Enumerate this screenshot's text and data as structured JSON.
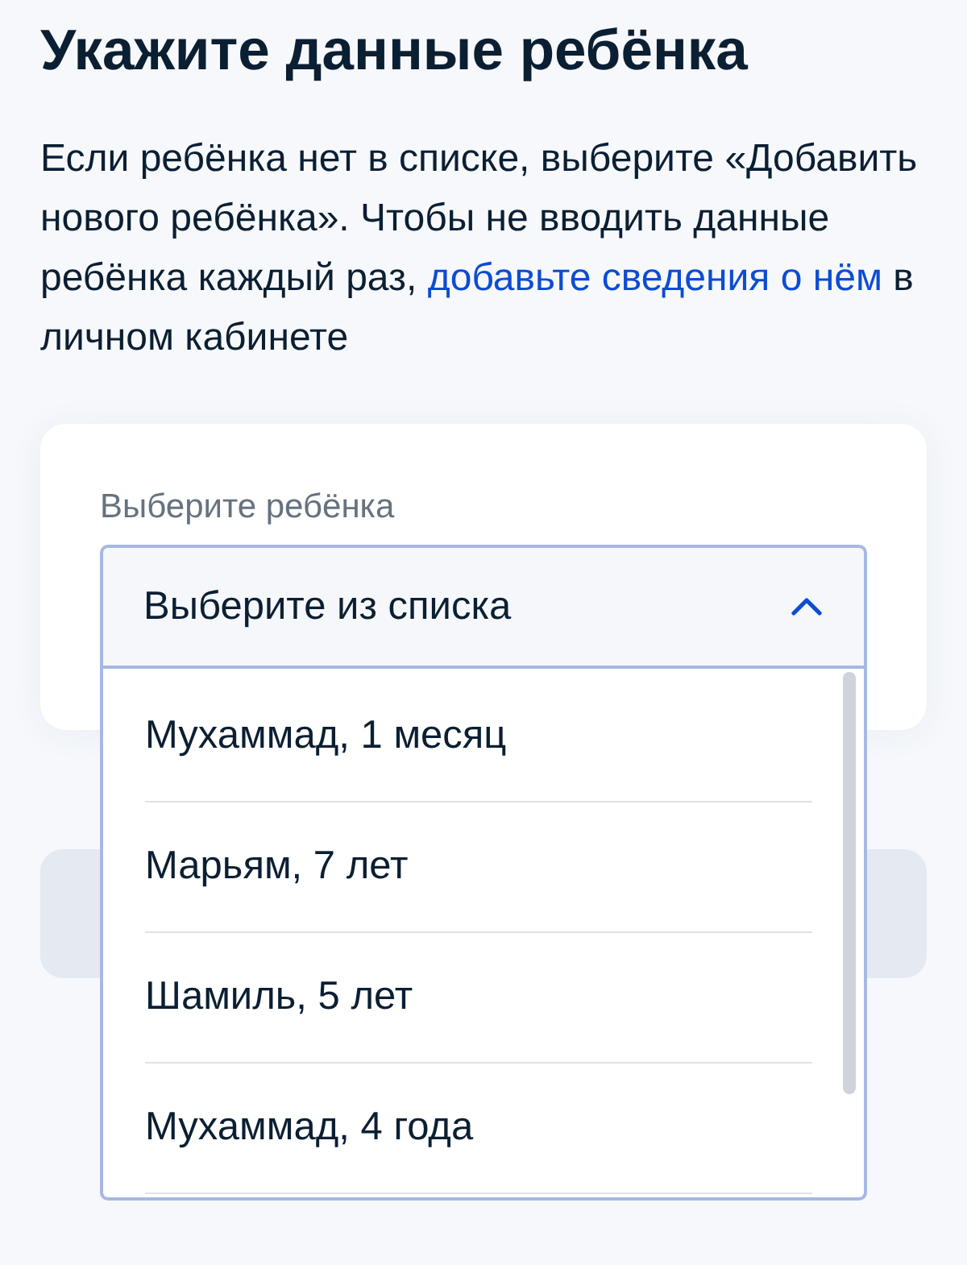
{
  "title": "Укажите данные ребёнка",
  "intro": {
    "text": "Если ребёнка нет в списке, выберите «Добавить нового ребёнка». Чтобы не вводить данные ребёнка каждый раз, ",
    "link": "добавьте сведения о нём",
    "text_after": " в личном кабинете"
  },
  "child_select": {
    "label": "Выберите ребёнка",
    "placeholder": "Выберите из списка",
    "expanded": true,
    "options": [
      {
        "label": "Мухаммад, 1 месяц",
        "selected": false
      },
      {
        "label": "Марьям, 7 лет",
        "selected": false
      },
      {
        "label": "Шамиль, 5 лет",
        "selected": false
      },
      {
        "label": "Мухаммад, 4 года",
        "selected": false
      }
    ]
  }
}
